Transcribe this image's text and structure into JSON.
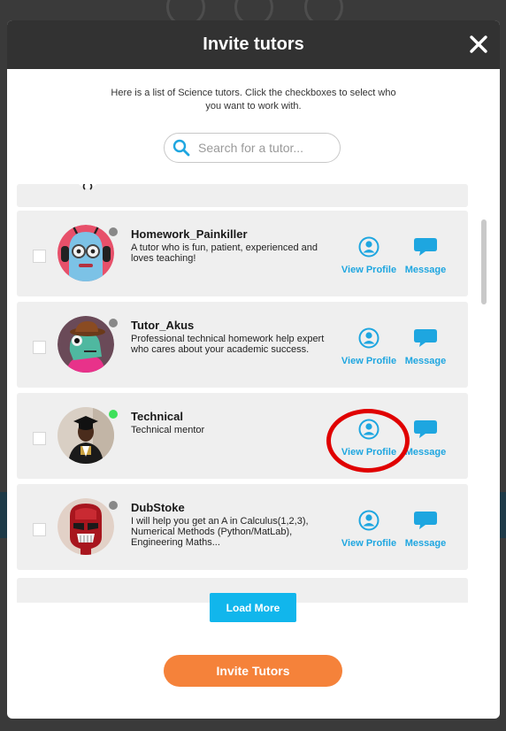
{
  "modal": {
    "title": "Invite tutors",
    "intro": "Here is a list of Science tutors. Click the checkboxes to select who you want to work with."
  },
  "search": {
    "placeholder": "Search for a tutor..."
  },
  "actions": {
    "view_profile": "View Profile",
    "message": "Message"
  },
  "tutors": [
    {
      "name": "Homework_Painkiller",
      "description": "A tutor who is fun, patient, experienced and loves teaching!",
      "status": "offline"
    },
    {
      "name": "Tutor_Akus",
      "description": "Professional technical homework help expert who cares about your academic success.",
      "status": "offline"
    },
    {
      "name": "Technical",
      "description": "Technical mentor",
      "status": "online"
    },
    {
      "name": "DubStoke",
      "description": "I will help you get an A in Calculus(1,2,3), Numerical Methods (Python/MatLab), Engineering Maths...",
      "status": "offline"
    }
  ],
  "buttons": {
    "load_more": "Load More",
    "invite": "Invite Tutors"
  },
  "colors": {
    "header_bg": "#323232",
    "accent_blue": "#1ea6e0",
    "load_more_bg": "#11b6ec",
    "invite_bg": "#f5823a",
    "online": "#3ee05a",
    "offline": "#888888",
    "highlight": "#e00000"
  }
}
